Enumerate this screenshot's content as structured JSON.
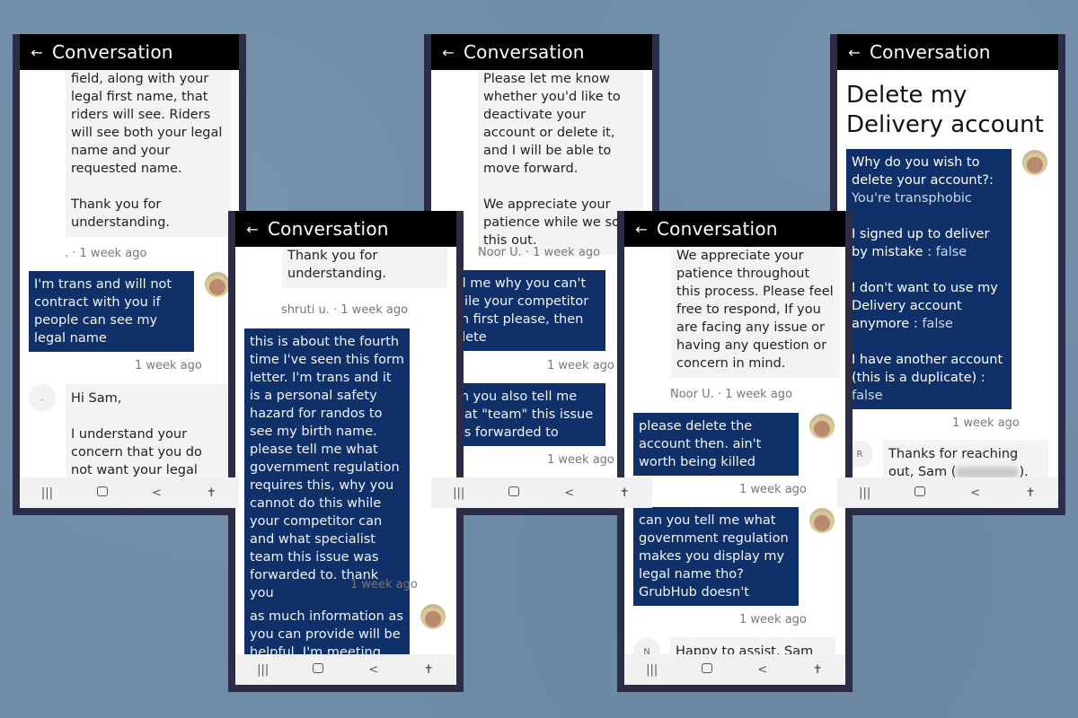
{
  "screens": [
    {
      "title": "Conversation",
      "messages": [
        {
          "type": "agent",
          "text": "field, along with your legal first name, that riders will see. Riders will see both your legal name and your requested name.\n\nThank you for understanding."
        },
        {
          "type": "meta",
          "text": ". · 1 week ago"
        },
        {
          "type": "user",
          "text": "I'm trans and will not contract with you if people can see my legal name"
        },
        {
          "type": "meta",
          "text": "1 week ago"
        },
        {
          "type": "agent",
          "avatar": ".",
          "text": "Hi Sam,\n\nI understand your concern that you do not want your legal name to"
        }
      ]
    },
    {
      "title": "Conversation",
      "messages": [
        {
          "type": "agent",
          "text": "Thank you for understanding."
        },
        {
          "type": "meta",
          "text": "shruti u. · 1 week ago"
        },
        {
          "type": "user",
          "text": "this is about the fourth time I've seen this form letter. I'm trans and it is a personal safety hazard for randos to see my birth name. please tell me what government regulation requires this, why you cannot do this while your competitor can and what specialist team this issue was forwarded to. thank you"
        },
        {
          "type": "meta",
          "text": "1 week ago"
        },
        {
          "type": "user",
          "text": "as much information as you can provide will be helpful. I'm meeting with"
        }
      ]
    },
    {
      "title": "Conversation",
      "messages": [
        {
          "type": "agent",
          "text": "Please let me know whether you'd like to deactivate your account or delete it, and I will be able to move forward.\n\nWe appreciate your patience while we sort this out."
        },
        {
          "type": "meta",
          "text": "Noor U. · 1 week ago"
        },
        {
          "type": "user",
          "text": "tell me why you can't while your competitor can first please, then delete"
        },
        {
          "type": "meta",
          "text": "1 week ago"
        },
        {
          "type": "user",
          "text": "can you also tell me what \"team\" this issue was forwarded to"
        },
        {
          "type": "meta",
          "text": "1 week ago"
        }
      ]
    },
    {
      "title": "Conversation",
      "messages": [
        {
          "type": "agent",
          "text": "We appreciate your patience throughout this process. Please feel free to respond, If you are facing any issue or having any question or concern in mind."
        },
        {
          "type": "meta",
          "text": "Noor U. · 1 week ago"
        },
        {
          "type": "user",
          "text": "please delete the account then. ain't worth being killed"
        },
        {
          "type": "meta",
          "text": "1 week ago"
        },
        {
          "type": "user",
          "text": "can you tell me what government regulation makes you display my legal name tho? GrubHub doesn't"
        },
        {
          "type": "meta",
          "text": "1 week ago"
        },
        {
          "type": "agent",
          "avatar": "N",
          "text": "Happy to assist, Sam"
        }
      ]
    },
    {
      "title": "Conversation",
      "heading": "Delete my Delivery account",
      "form": [
        {
          "q": "Why do you wish to delete your account?:",
          "a": "You're transphobic"
        },
        {
          "q": "I signed up to deliver by mistake",
          "a": "false"
        },
        {
          "q": "I don't want to use my Delivery account anymore",
          "a": "false"
        },
        {
          "q": "I have another account (this is a duplicate)",
          "a": "false"
        }
      ],
      "form_meta": "1 week ago",
      "reply": {
        "avatar": "R",
        "text_before": "Thanks for reaching out, Sam (",
        "text_after": ")."
      }
    }
  ],
  "nav": {
    "recents": "|||",
    "back": "<",
    "accessibility": "✝"
  }
}
